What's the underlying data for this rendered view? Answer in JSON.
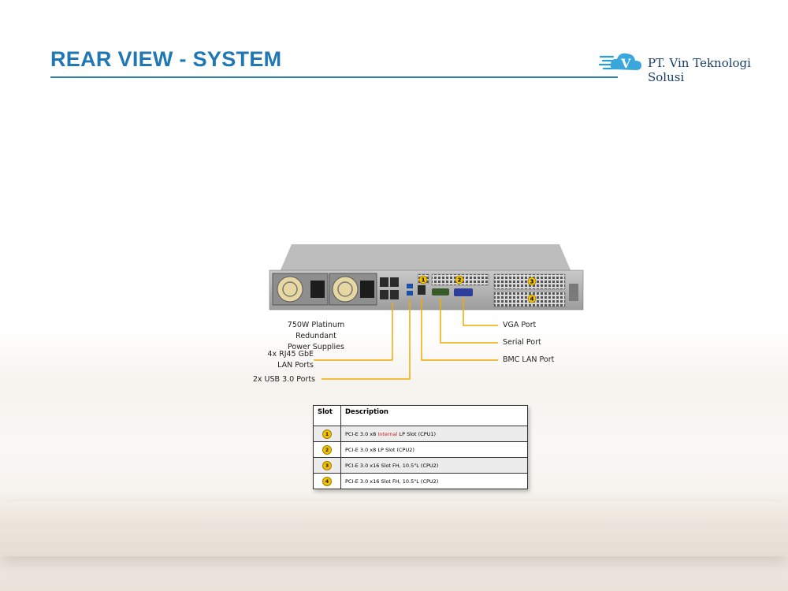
{
  "page": {
    "title": "REAR VIEW - SYSTEM"
  },
  "brand": {
    "name": "PT. Vin Teknologi Solusi",
    "logo_icon": "cloud-v-logo-icon"
  },
  "server_badges": [
    "1",
    "2",
    "3",
    "4"
  ],
  "callouts": {
    "psu": [
      "750W Platinum Redundant",
      "Power Supplies"
    ],
    "lan": [
      "4x RJ45 GbE",
      "LAN Ports"
    ],
    "usb": "2x USB 3.0 Ports",
    "vga": "VGA Port",
    "serial": "Serial Port",
    "bmc": "BMC LAN Port"
  },
  "table": {
    "headers": [
      "Slot",
      "Description"
    ],
    "rows": [
      {
        "slot": "1",
        "pre": "PCI-E 3.0 x8 ",
        "highlight": "Internal",
        "post": " LP Slot  (CPU1)"
      },
      {
        "slot": "2",
        "pre": "PCI-E 3.0 x8 LP Slot (CPU2)",
        "highlight": "",
        "post": ""
      },
      {
        "slot": "3",
        "pre": "PCI-E 3.0 x16 Slot FH, 10.5\"L (CPU2)",
        "highlight": "",
        "post": ""
      },
      {
        "slot": "4",
        "pre": "PCI-E 3.0 x16 Slot FH, 10.5\"L (CPU2)",
        "highlight": "",
        "post": ""
      }
    ]
  },
  "colors": {
    "title": "#1f77b4",
    "callout_line": "#f2a900",
    "badge": "#f2c200",
    "internal": "#d42020"
  }
}
